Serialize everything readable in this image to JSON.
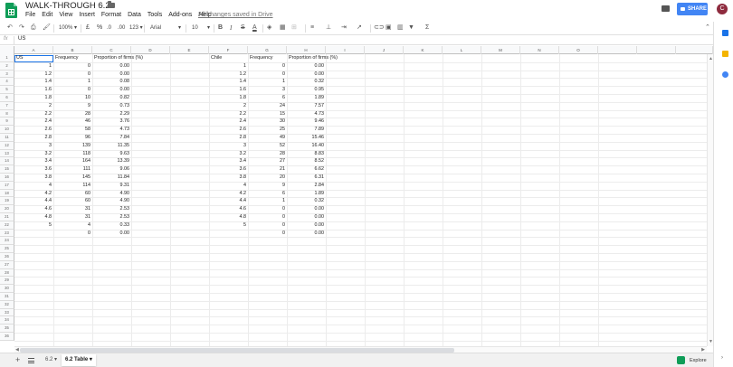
{
  "header": {
    "title": "WALK-THROUGH 6.2",
    "menus": [
      "File",
      "Edit",
      "View",
      "Insert",
      "Format",
      "Data",
      "Tools",
      "Add-ons",
      "Help"
    ],
    "saved_status": "All changes saved in Drive",
    "share_label": "SHARE",
    "avatar_letter": "C"
  },
  "toolbar": {
    "zoom": "100%",
    "currency": "£",
    "percent": "%",
    "decrease_decimals": ".0",
    "increase_decimals": ".00",
    "more_formats": "123",
    "font": "Arial",
    "font_size": "10",
    "bold": "B",
    "italic": "I",
    "strikethrough": "S",
    "text_color": "A"
  },
  "formula_bar": {
    "fx": "fx",
    "value": "US"
  },
  "grid": {
    "columns": [
      "A",
      "B",
      "C",
      "D",
      "E",
      "F",
      "G",
      "H",
      "I",
      "J",
      "K",
      "L",
      "M",
      "N",
      "O"
    ],
    "row_count": 36,
    "selected_cell": "A1",
    "us_table": {
      "header_country": "US",
      "header_frequency": "Frequency",
      "header_proportion": "Proportion of firms (%)",
      "rows": [
        [
          "1",
          "0",
          "0.00"
        ],
        [
          "1.2",
          "0",
          "0.00"
        ],
        [
          "1.4",
          "1",
          "0.08"
        ],
        [
          "1.6",
          "0",
          "0.00"
        ],
        [
          "1.8",
          "10",
          "0.82"
        ],
        [
          "2",
          "9",
          "0.73"
        ],
        [
          "2.2",
          "28",
          "2.29"
        ],
        [
          "2.4",
          "46",
          "3.76"
        ],
        [
          "2.6",
          "58",
          "4.73"
        ],
        [
          "2.8",
          "96",
          "7.84"
        ],
        [
          "3",
          "139",
          "11.35"
        ],
        [
          "3.2",
          "118",
          "9.63"
        ],
        [
          "3.4",
          "164",
          "13.39"
        ],
        [
          "3.6",
          "111",
          "9.06"
        ],
        [
          "3.8",
          "145",
          "11.84"
        ],
        [
          "4",
          "114",
          "9.31"
        ],
        [
          "4.2",
          "60",
          "4.90"
        ],
        [
          "4.4",
          "60",
          "4.90"
        ],
        [
          "4.6",
          "31",
          "2.53"
        ],
        [
          "4.8",
          "31",
          "2.53"
        ],
        [
          "5",
          "4",
          "0.33"
        ],
        [
          "",
          "0",
          "0.00"
        ]
      ]
    },
    "chile_table": {
      "header_country": "Chile",
      "header_frequency": "Frequency",
      "header_proportion": "Proportion of firms (%)",
      "rows": [
        [
          "1",
          "0",
          "0.00"
        ],
        [
          "1.2",
          "0",
          "0.00"
        ],
        [
          "1.4",
          "1",
          "0.32"
        ],
        [
          "1.6",
          "3",
          "0.95"
        ],
        [
          "1.8",
          "6",
          "1.89"
        ],
        [
          "2",
          "24",
          "7.57"
        ],
        [
          "2.2",
          "15",
          "4.73"
        ],
        [
          "2.4",
          "30",
          "9.46"
        ],
        [
          "2.6",
          "25",
          "7.89"
        ],
        [
          "2.8",
          "49",
          "15.46"
        ],
        [
          "3",
          "52",
          "16.40"
        ],
        [
          "3.2",
          "28",
          "8.83"
        ],
        [
          "3.4",
          "27",
          "8.52"
        ],
        [
          "3.6",
          "21",
          "6.62"
        ],
        [
          "3.8",
          "20",
          "6.31"
        ],
        [
          "4",
          "9",
          "2.84"
        ],
        [
          "4.2",
          "6",
          "1.89"
        ],
        [
          "4.4",
          "1",
          "0.32"
        ],
        [
          "4.6",
          "0",
          "0.00"
        ],
        [
          "4.8",
          "0",
          "0.00"
        ],
        [
          "5",
          "0",
          "0.00"
        ],
        [
          "",
          "0",
          "0.00"
        ]
      ]
    }
  },
  "sheets": {
    "tabs": [
      "6.2",
      "6.2 Table"
    ],
    "active": "6.2 Table",
    "explore_label": "Explore"
  },
  "colors": {
    "brand_green": "#0f9d58",
    "share_blue": "#4285f4",
    "selection_blue": "#1a73e8"
  }
}
